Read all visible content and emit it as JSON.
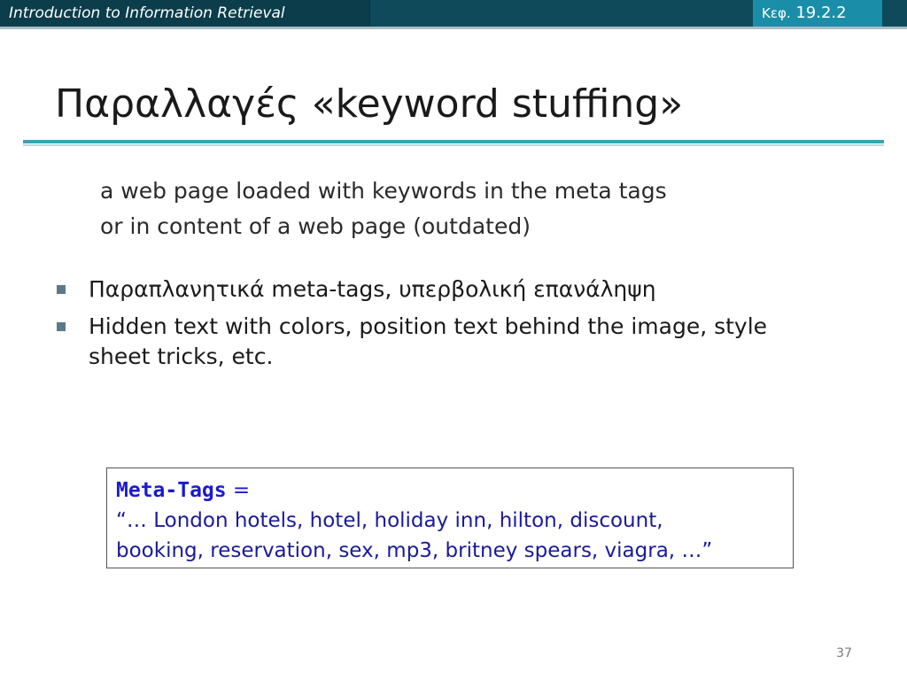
{
  "header": {
    "course": "Introduction to Information Retrieval",
    "chapter_prefix": "Κεφ.",
    "chapter_number": "19.2.2"
  },
  "slide": {
    "title": "Παραλλαγές «keyword stuffing»",
    "description_lines": [
      "a web page loaded with keywords in the meta tags",
      "or in content of a web page (outdated)"
    ],
    "bullets": [
      "Παραπλανητικά meta-tags, υπερβολική επανάληψη",
      "Hidden text with colors, position text behind the image, style sheet tricks, etc."
    ],
    "meta_box": {
      "label": "Meta-Tags",
      "equals": " =",
      "line1": "“… London hotels, hotel, holiday inn, hilton, discount,",
      "line2": "booking, reservation, sex, mp3, britney spears, viagra, …”"
    },
    "page_number": "37"
  },
  "colors": {
    "header_dark": "#0b3d4b",
    "header_accent": "#1a8ea8",
    "rule": "#38a3b4",
    "meta_text": "#1a1ad0"
  }
}
